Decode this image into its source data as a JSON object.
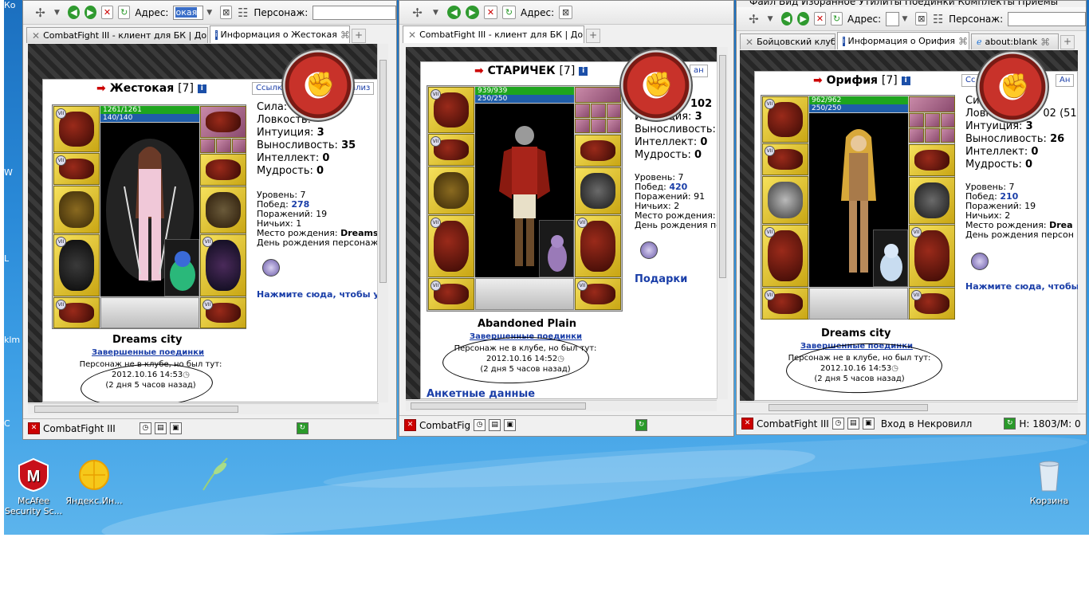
{
  "toolbar": {
    "address_label": "Адрес:",
    "address_value_1": "окая",
    "address_value_2": "",
    "character_label": "Персонаж:",
    "menu_text": "Файл  Вид  Избранное  Утилиты  Поединки  Комплекты  Приемы"
  },
  "left_strip": {
    "top": "Ко",
    "a": "W",
    "b": "klm",
    "c": "С",
    "d": "L"
  },
  "windows": [
    {
      "tabs": [
        {
          "label": "CombatFight III - клиент для БК | До...",
          "active": false
        },
        {
          "label": "Информация о Жестокая",
          "active": true
        }
      ],
      "char": {
        "name": "Жестокая",
        "level": "[7]",
        "hp": "1261/1261",
        "mp": "140/140",
        "stats": [
          {
            "label": "Сила:",
            "value": ""
          },
          {
            "label": "Ловкость:",
            "value": ""
          },
          {
            "label": "Интуиция:",
            "value": "3"
          },
          {
            "label": "Выносливость:",
            "value": "35"
          },
          {
            "label": "Интеллект:",
            "value": "0"
          },
          {
            "label": "Мудрость:",
            "value": "0"
          }
        ],
        "info": {
          "level": "Уровень: 7",
          "wins_label": "Побед:",
          "wins": "278",
          "losses": "Поражений: 19",
          "draws": "Ничьих: 1",
          "birthplace_label": "Место рождения:",
          "birthplace": "Dreams c",
          "birthday": "День рождения персонажа"
        },
        "click_link": "Нажмите сюда, чтобы уви",
        "city": "Dreams city",
        "duels": "Завершенные поединки",
        "seen_1": "Персонаж не в клубе, но был тут:",
        "seen_2": "2012.10.16 14:53",
        "seen_3": "(2 дня 5 часов назад)",
        "right_tab_1": "Ссылк",
        "right_tab_2": "ализ"
      },
      "status": "CombatFight III"
    },
    {
      "tabs": [
        {
          "label": "CombatFight III - клиент для БК | До...",
          "active": false
        }
      ],
      "char": {
        "name": "СТАРИЧЕК",
        "level": "[7]",
        "hp": "939/939",
        "mp": "250/250",
        "stats": [
          {
            "label": "",
            "value": "102"
          },
          {
            "label": "Интуиция:",
            "value": "3"
          },
          {
            "label": "Выносливость:",
            "value": ""
          },
          {
            "label": "Интеллект:",
            "value": "0"
          },
          {
            "label": "Мудрость:",
            "value": "0"
          }
        ],
        "info": {
          "level": "Уровень: 7",
          "wins_label": "Побед:",
          "wins": "420",
          "losses": "Поражений: 91",
          "draws": "Ничьих: 2",
          "birthplace_label": "Место рождения:",
          "birthplace": "",
          "birthday": "День рождения пе"
        },
        "gifts": "Подарки",
        "city": "Abandoned Plain",
        "duels": "Завершенные поединки",
        "seen_1": "Персонаж не в клубе, но был тут:",
        "seen_2": "2012.10.16 14:52",
        "seen_3": "(2 дня 5 часов назад)",
        "anketa": "Анкетные данные",
        "right_tab_1": "ан"
      },
      "status": "CombatFig"
    },
    {
      "tabs": [
        {
          "label": "Бойцовский клуб",
          "active": false
        },
        {
          "label": "Информация о Орифия",
          "active": true
        },
        {
          "label": "about:blank",
          "active": false
        }
      ],
      "char": {
        "name": "Орифия",
        "level": "[7]",
        "hp": "962/962",
        "mp": "250/250",
        "stats": [
          {
            "label": "Сил",
            "value": ""
          },
          {
            "label": "Ловк",
            "value": "02 (51"
          },
          {
            "label": "Интуиция:",
            "value": "3"
          },
          {
            "label": "Выносливость:",
            "value": "26"
          },
          {
            "label": "Интеллект:",
            "value": "0"
          },
          {
            "label": "Мудрость:",
            "value": "0"
          }
        ],
        "info": {
          "level": "Уровень: 7",
          "wins_label": "Побед:",
          "wins": "210",
          "losses": "Поражений: 19",
          "draws": "Ничьих: 2",
          "birthplace_label": "Место рождения:",
          "birthplace": "Drea",
          "birthday": "День рождения персон"
        },
        "click_link": "Нажмите сюда, чтобы",
        "city": "Dreams city",
        "duels": "Завершенные поединки",
        "seen_1": "Персонаж не в клубе, но был тут:",
        "seen_2": "2012.10.16 14:53",
        "seen_3": "(2 дня 5 часов назад)",
        "right_tab_1": "Сс",
        "right_tab_2": "Ан"
      },
      "status": "CombatFight III",
      "status_extra": "Вход в Некровилл",
      "status_hm": "H: 1803/M: 0"
    }
  ],
  "desktop_icons": [
    {
      "label": "McAfee Security Sc..."
    },
    {
      "label": "Яндекс.Ин..."
    },
    {
      "label": "Корзина"
    }
  ],
  "colors": {
    "desktop": "#2a8ad8",
    "link": "#1a3ea8",
    "hp": "#1ea51e",
    "mp": "#1f5da8",
    "slot": "#e0c43a"
  }
}
